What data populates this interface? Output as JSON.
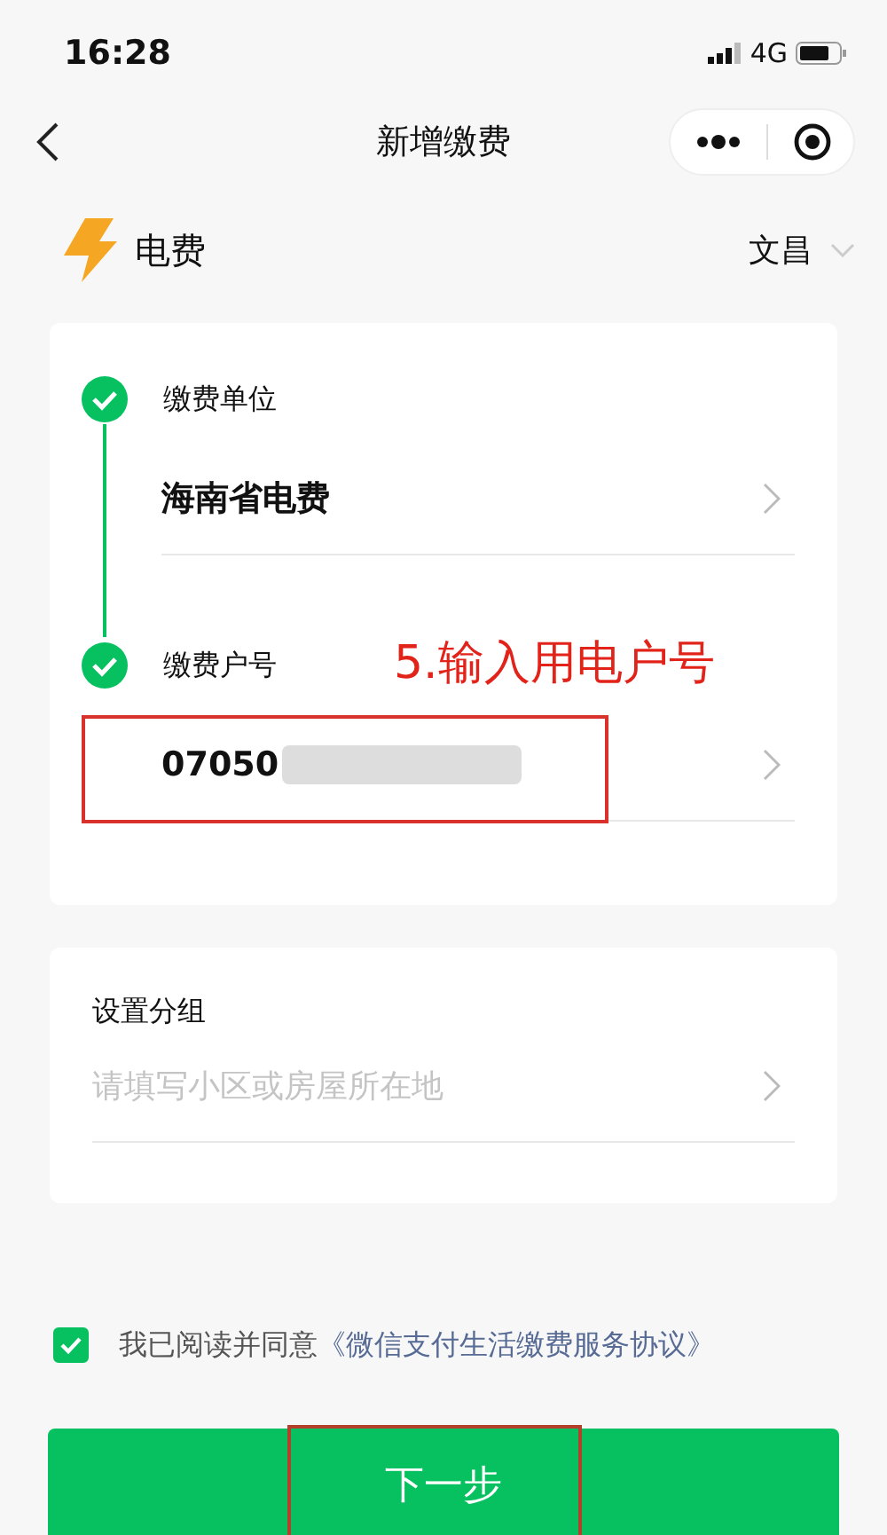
{
  "status_bar": {
    "time": "16:28",
    "network": "4G"
  },
  "nav": {
    "title": "新增缴费"
  },
  "category": {
    "name": "电费",
    "region": "文昌"
  },
  "steps": [
    {
      "label": "缴费单位",
      "value": "海南省电费",
      "done": true,
      "redacted": false
    },
    {
      "label": "缴费户号",
      "value": "07050",
      "done": true,
      "redacted": true
    }
  ],
  "group": {
    "label": "设置分组",
    "placeholder": "请填写小区或房屋所在地"
  },
  "agreement": {
    "checked": true,
    "text": "我已阅读并同意",
    "link": "《微信支付生活缴费服务协议》"
  },
  "next_button": {
    "label": "下一步"
  },
  "annotations": [
    {
      "text": "5.输入用电户号"
    }
  ]
}
